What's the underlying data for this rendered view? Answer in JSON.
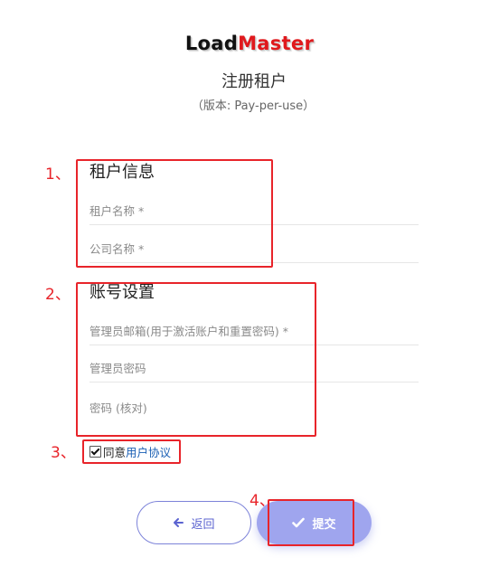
{
  "logo": {
    "part1": "Load",
    "part2": "Master"
  },
  "header": {
    "title": "注册租户",
    "subtitle": "（版本: Pay-per-use）"
  },
  "tenant_section": {
    "title": "租户信息",
    "fields": [
      {
        "label": "租户名称 *"
      },
      {
        "label": "公司名称 *"
      }
    ]
  },
  "account_section": {
    "title": "账号设置",
    "fields": [
      {
        "label": "管理员邮箱(用于激活账户和重置密码) *"
      },
      {
        "label": "管理员密码"
      },
      {
        "label": "密码 (核对)"
      }
    ]
  },
  "agreement": {
    "checked": true,
    "prefix": "同意",
    "link": "用户协议"
  },
  "buttons": {
    "back": "返回",
    "submit": "提交"
  },
  "annotations": {
    "step1": "1、",
    "step2": "2、",
    "step3": "3、",
    "step4": "4、"
  },
  "colors": {
    "annotation_red": "#e8242a",
    "primary_blue": "#9fa5ee",
    "back_border": "#7d83d9",
    "link_blue": "#1a5fb4",
    "logo_red": "#e0191d"
  }
}
